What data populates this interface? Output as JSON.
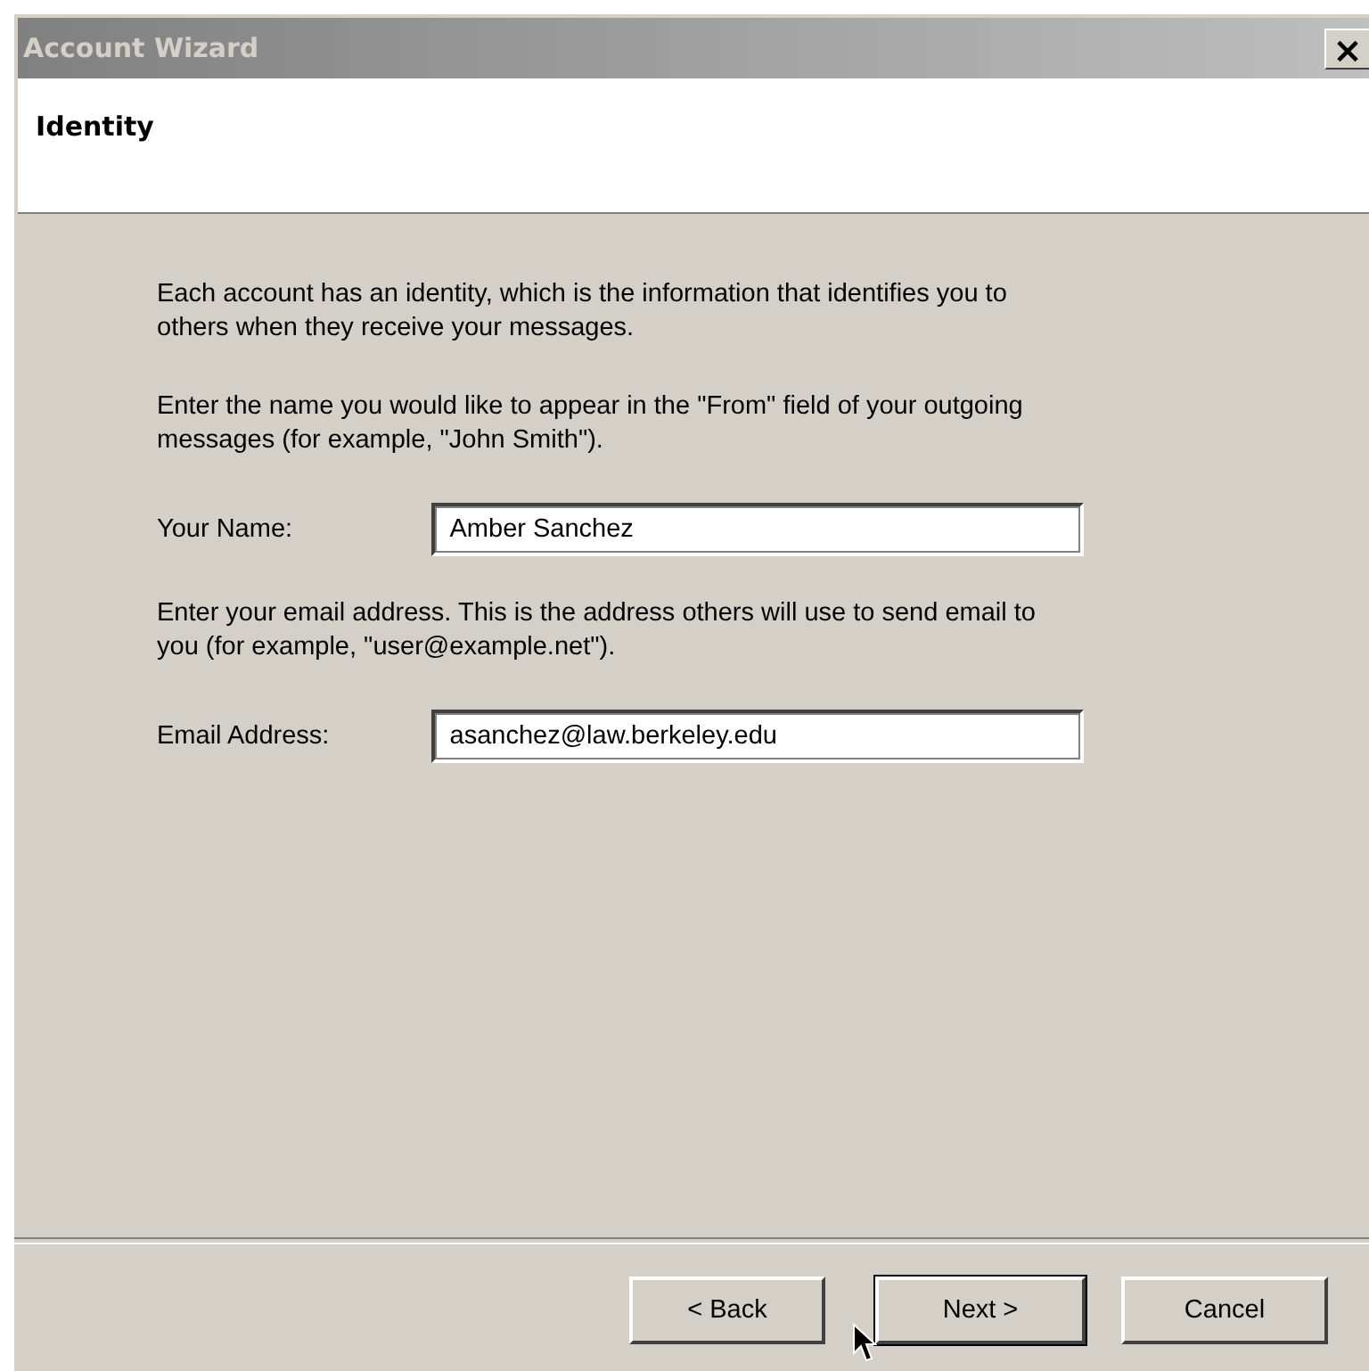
{
  "window": {
    "title": "Account Wizard",
    "close_label": "×"
  },
  "header": {
    "title": "Identity"
  },
  "body": [
    {
      "kind": "paragraph",
      "text": "Each account has an identity, which is the information that identifies you to others when they receive your messages."
    },
    {
      "kind": "paragraph",
      "text": "Enter the name you would like to appear in the \"From\" field of your outgoing messages (for example, \"John Smith\")."
    },
    {
      "kind": "field",
      "label": "Your Name:",
      "value": "Amber Sanchez"
    },
    {
      "kind": "paragraph",
      "text": "Enter your email address. This is the address others will use to send email to you (for example, \"user@example.net\")."
    },
    {
      "kind": "field",
      "label": "Email Address:",
      "value": "asanchez@law.berkeley.edu"
    }
  ],
  "buttons": [
    {
      "label": "< Back",
      "focused": false
    },
    {
      "label": "Next >",
      "focused": true
    },
    {
      "label": "Cancel",
      "focused": false
    }
  ]
}
